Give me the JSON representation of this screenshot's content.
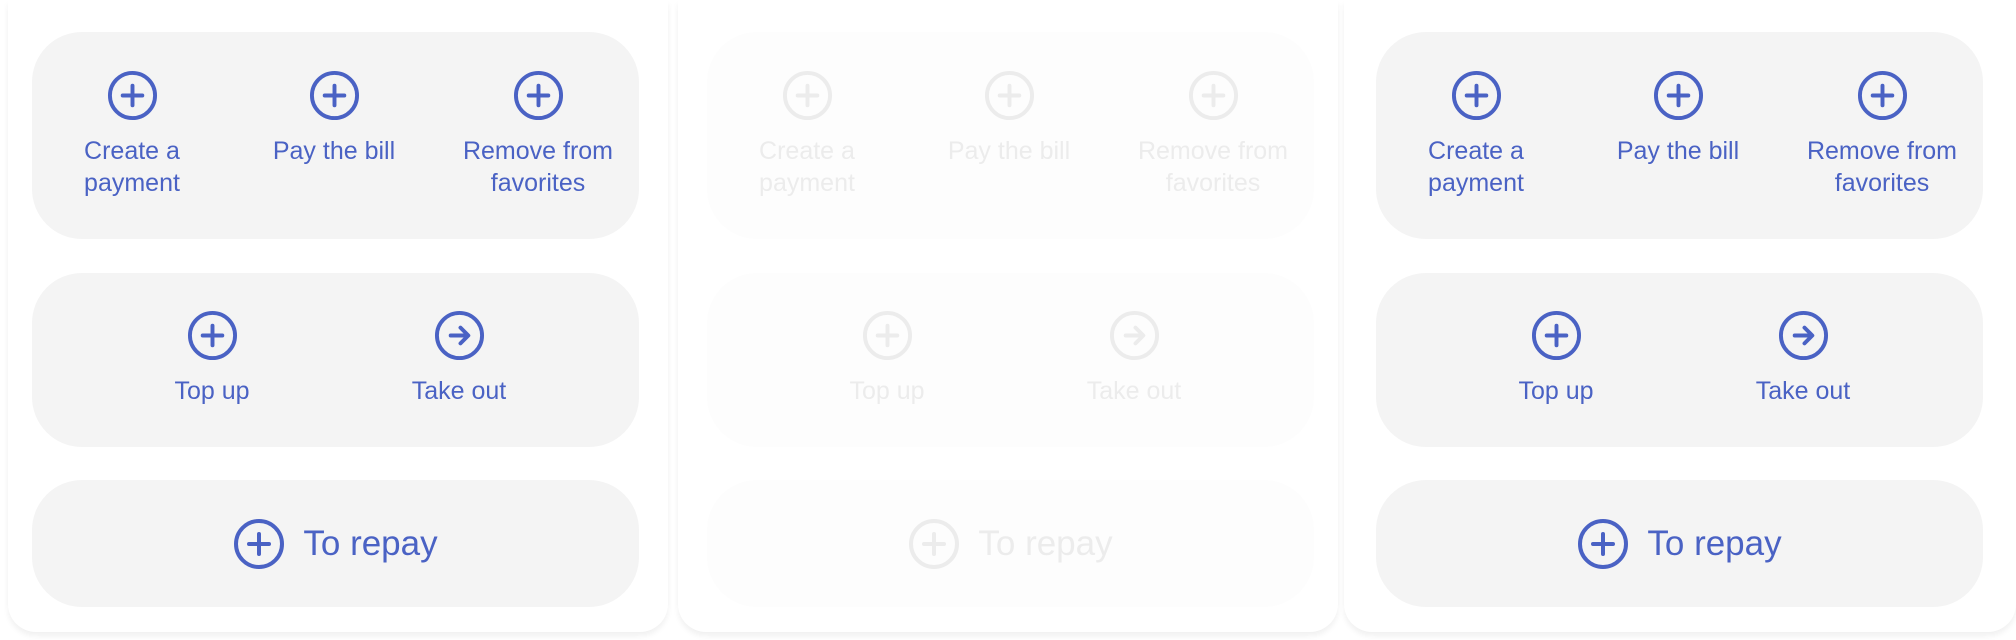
{
  "colors": {
    "accent": "#4a62c4",
    "faded": "#ececec",
    "panel": "#f4f4f4"
  },
  "columns": [
    {
      "state": "enabled",
      "actions": [
        {
          "label": "Create a\npayment",
          "icon": "plus-circle-icon"
        },
        {
          "label": "Pay the bill",
          "icon": "plus-circle-icon"
        },
        {
          "label": "Remove from\nfavorites",
          "icon": "plus-circle-icon"
        }
      ],
      "transfers": [
        {
          "label": "Top up",
          "icon": "plus-circle-icon"
        },
        {
          "label": "Take out",
          "icon": "arrow-right-circle-icon"
        }
      ],
      "repay": {
        "label": "To repay",
        "icon": "plus-circle-icon"
      }
    },
    {
      "state": "disabled",
      "actions": [
        {
          "label": "Create a\npayment",
          "icon": "plus-circle-icon"
        },
        {
          "label": "Pay the bill",
          "icon": "plus-circle-icon"
        },
        {
          "label": "Remove from\nfavorites",
          "icon": "plus-circle-icon"
        }
      ],
      "transfers": [
        {
          "label": "Top up",
          "icon": "plus-circle-icon"
        },
        {
          "label": "Take out",
          "icon": "arrow-right-circle-icon"
        }
      ],
      "repay": {
        "label": "To repay",
        "icon": "plus-circle-icon"
      }
    },
    {
      "state": "enabled",
      "actions": [
        {
          "label": "Create a\npayment",
          "icon": "plus-circle-icon"
        },
        {
          "label": "Pay the bill",
          "icon": "plus-circle-icon"
        },
        {
          "label": "Remove from\nfavorites",
          "icon": "plus-circle-icon"
        }
      ],
      "transfers": [
        {
          "label": "Top up",
          "icon": "plus-circle-icon"
        },
        {
          "label": "Take out",
          "icon": "arrow-right-circle-icon"
        }
      ],
      "repay": {
        "label": "To repay",
        "icon": "plus-circle-icon"
      }
    }
  ]
}
